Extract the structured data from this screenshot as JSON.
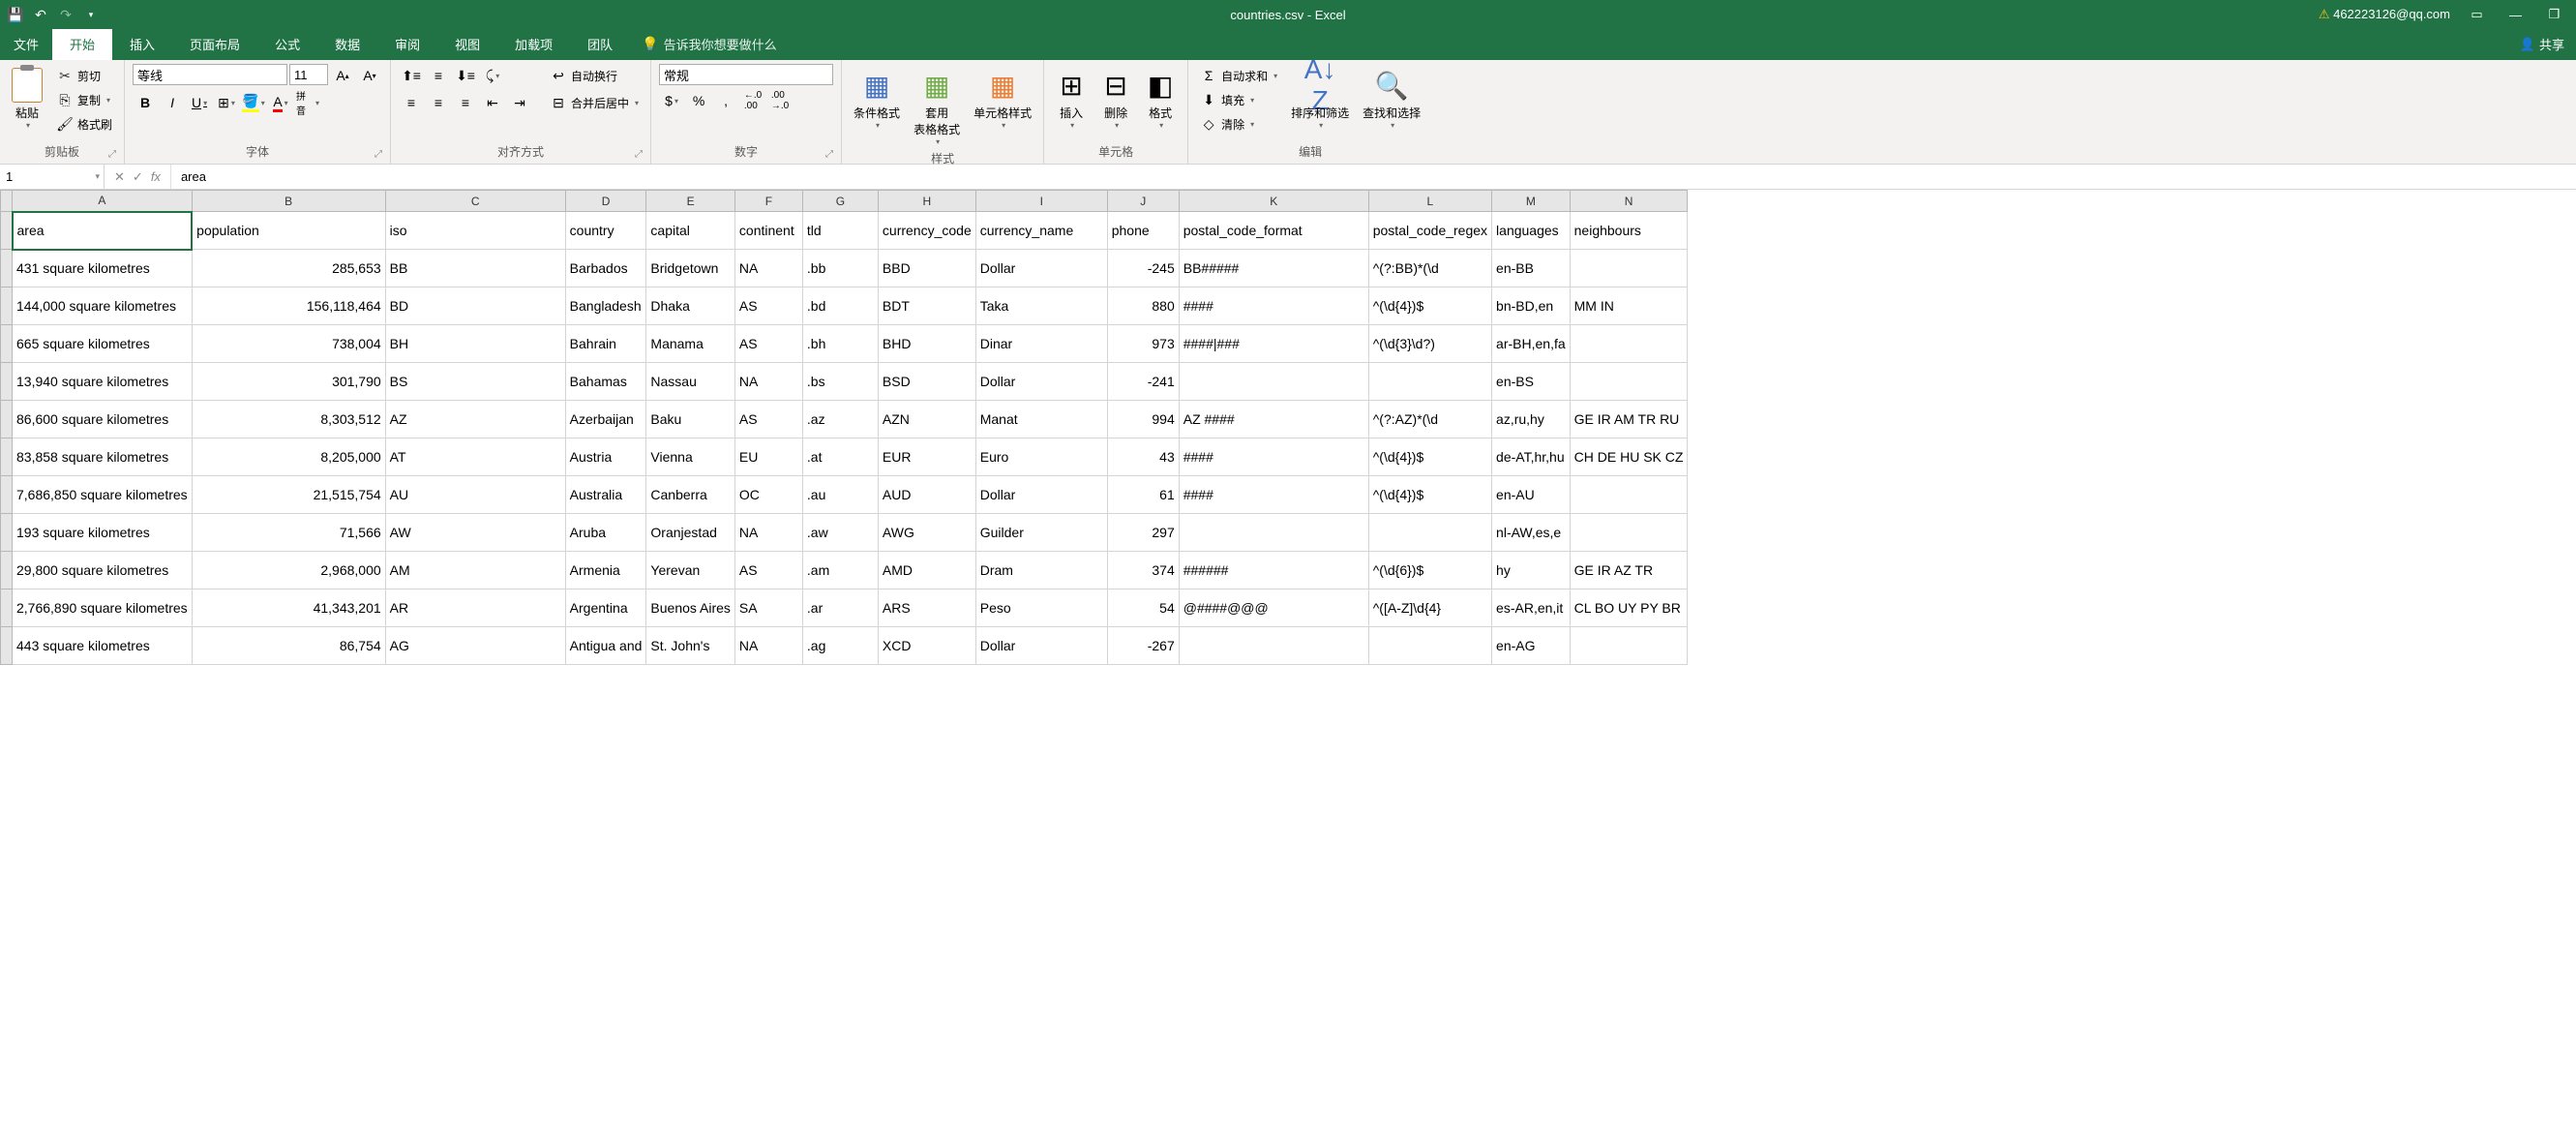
{
  "title_bar": {
    "filename": "countries.csv - Excel",
    "user": "462223126@qq.com"
  },
  "tabs": {
    "file": "文件",
    "home": "开始",
    "insert": "插入",
    "page_layout": "页面布局",
    "formulas": "公式",
    "data": "数据",
    "review": "审阅",
    "view": "视图",
    "addins": "加载项",
    "team": "团队",
    "tell_me": "告诉我你想要做什么",
    "share": "共享"
  },
  "ribbon": {
    "clipboard": {
      "label": "剪贴板",
      "paste": "粘贴",
      "cut": "剪切",
      "copy": "复制",
      "brush": "格式刷"
    },
    "font": {
      "label": "字体",
      "name": "等线",
      "size": "11",
      "pinyin": "拼音"
    },
    "align": {
      "label": "对齐方式",
      "wrap": "自动换行",
      "merge": "合并后居中"
    },
    "number": {
      "label": "数字",
      "format": "常规"
    },
    "styles": {
      "label": "样式",
      "conditional": "条件格式",
      "table": "套用\n表格格式",
      "cell": "单元格样式"
    },
    "cells": {
      "label": "单元格",
      "insert": "插入",
      "delete": "删除",
      "format": "格式"
    },
    "editing": {
      "label": "编辑",
      "autosum": "自动求和",
      "fill": "填充",
      "clear": "清除",
      "sort": "排序和筛选",
      "find": "查找和选择"
    }
  },
  "formula": {
    "cell_ref": "1",
    "value": "area"
  },
  "columns": [
    "A",
    "B",
    "C",
    "D",
    "E",
    "F",
    "G",
    "H",
    "I",
    "J",
    "K",
    "L",
    "M",
    "N"
  ],
  "headers": [
    "area",
    "population",
    "iso",
    "country",
    "capital",
    "continent",
    "tld",
    "currency_code",
    "currency_name",
    "phone",
    "postal_code_format",
    "postal_code_regex",
    "languages",
    "neighbours"
  ],
  "rows": [
    {
      "area": "431 square kilometres",
      "population": "285,653",
      "iso": "BB",
      "country": "Barbados",
      "capital": "Bridgetown",
      "continent": "NA",
      "tld": ".bb",
      "cc": "BBD",
      "cn": "Dollar",
      "phone": "-245",
      "pcf": "BB#####",
      "pcr": "^(?:BB)*(\\d",
      "lang": "en-BB",
      "neigh": ""
    },
    {
      "area": "144,000 square kilometres",
      "population": "156,118,464",
      "iso": "BD",
      "country": "Bangladesh",
      "capital": "Dhaka",
      "continent": "AS",
      "tld": ".bd",
      "cc": "BDT",
      "cn": "Taka",
      "phone": "880",
      "pcf": "####",
      "pcr": "^(\\d{4})$",
      "lang": "bn-BD,en",
      "neigh": "MM IN"
    },
    {
      "area": "665 square kilometres",
      "population": "738,004",
      "iso": "BH",
      "country": "Bahrain",
      "capital": "Manama",
      "continent": "AS",
      "tld": ".bh",
      "cc": "BHD",
      "cn": "Dinar",
      "phone": "973",
      "pcf": "####|###",
      "pcr": "^(\\d{3}\\d?)",
      "lang": "ar-BH,en,fa",
      "neigh": ""
    },
    {
      "area": "13,940 square kilometres",
      "population": "301,790",
      "iso": "BS",
      "country": "Bahamas",
      "capital": "Nassau",
      "continent": "NA",
      "tld": ".bs",
      "cc": "BSD",
      "cn": "Dollar",
      "phone": "-241",
      "pcf": "",
      "pcr": "",
      "lang": "en-BS",
      "neigh": ""
    },
    {
      "area": "86,600 square kilometres",
      "population": "8,303,512",
      "iso": "AZ",
      "country": "Azerbaijan",
      "capital": "Baku",
      "continent": "AS",
      "tld": ".az",
      "cc": "AZN",
      "cn": "Manat",
      "phone": "994",
      "pcf": "AZ ####",
      "pcr": "^(?:AZ)*(\\d",
      "lang": "az,ru,hy",
      "neigh": "GE IR AM TR RU"
    },
    {
      "area": "83,858 square kilometres",
      "population": "8,205,000",
      "iso": "AT",
      "country": "Austria",
      "capital": "Vienna",
      "continent": "EU",
      "tld": ".at",
      "cc": "EUR",
      "cn": "Euro",
      "phone": "43",
      "pcf": "####",
      "pcr": "^(\\d{4})$",
      "lang": "de-AT,hr,hu",
      "neigh": "CH DE HU SK CZ"
    },
    {
      "area": "7,686,850 square kilometres",
      "population": "21,515,754",
      "iso": "AU",
      "country": "Australia",
      "capital": "Canberra",
      "continent": "OC",
      "tld": ".au",
      "cc": "AUD",
      "cn": "Dollar",
      "phone": "61",
      "pcf": "####",
      "pcr": "^(\\d{4})$",
      "lang": "en-AU",
      "neigh": ""
    },
    {
      "area": "193 square kilometres",
      "population": "71,566",
      "iso": "AW",
      "country": "Aruba",
      "capital": "Oranjestad",
      "continent": "NA",
      "tld": ".aw",
      "cc": "AWG",
      "cn": "Guilder",
      "phone": "297",
      "pcf": "",
      "pcr": "",
      "lang": "nl-AW,es,e",
      "neigh": ""
    },
    {
      "area": "29,800 square kilometres",
      "population": "2,968,000",
      "iso": "AM",
      "country": "Armenia",
      "capital": "Yerevan",
      "continent": "AS",
      "tld": ".am",
      "cc": "AMD",
      "cn": "Dram",
      "phone": "374",
      "pcf": "######",
      "pcr": "^(\\d{6})$",
      "lang": "hy",
      "neigh": "GE IR AZ TR"
    },
    {
      "area": "2,766,890 square kilometres",
      "population": "41,343,201",
      "iso": "AR",
      "country": "Argentina",
      "capital": "Buenos Aires",
      "continent": "SA",
      "tld": ".ar",
      "cc": "ARS",
      "cn": "Peso",
      "phone": "54",
      "pcf": "@####@@@",
      "pcr": "^([A-Z]\\d{4}",
      "lang": "es-AR,en,it",
      "neigh": "CL BO UY PY BR"
    },
    {
      "area": "443 square kilometres",
      "population": "86,754",
      "iso": "AG",
      "country": "Antigua and",
      "capital": "St. John's",
      "continent": "NA",
      "tld": ".ag",
      "cc": "XCD",
      "cn": "Dollar",
      "phone": "-267",
      "pcf": "",
      "pcr": "",
      "lang": "en-AG",
      "neigh": ""
    }
  ]
}
